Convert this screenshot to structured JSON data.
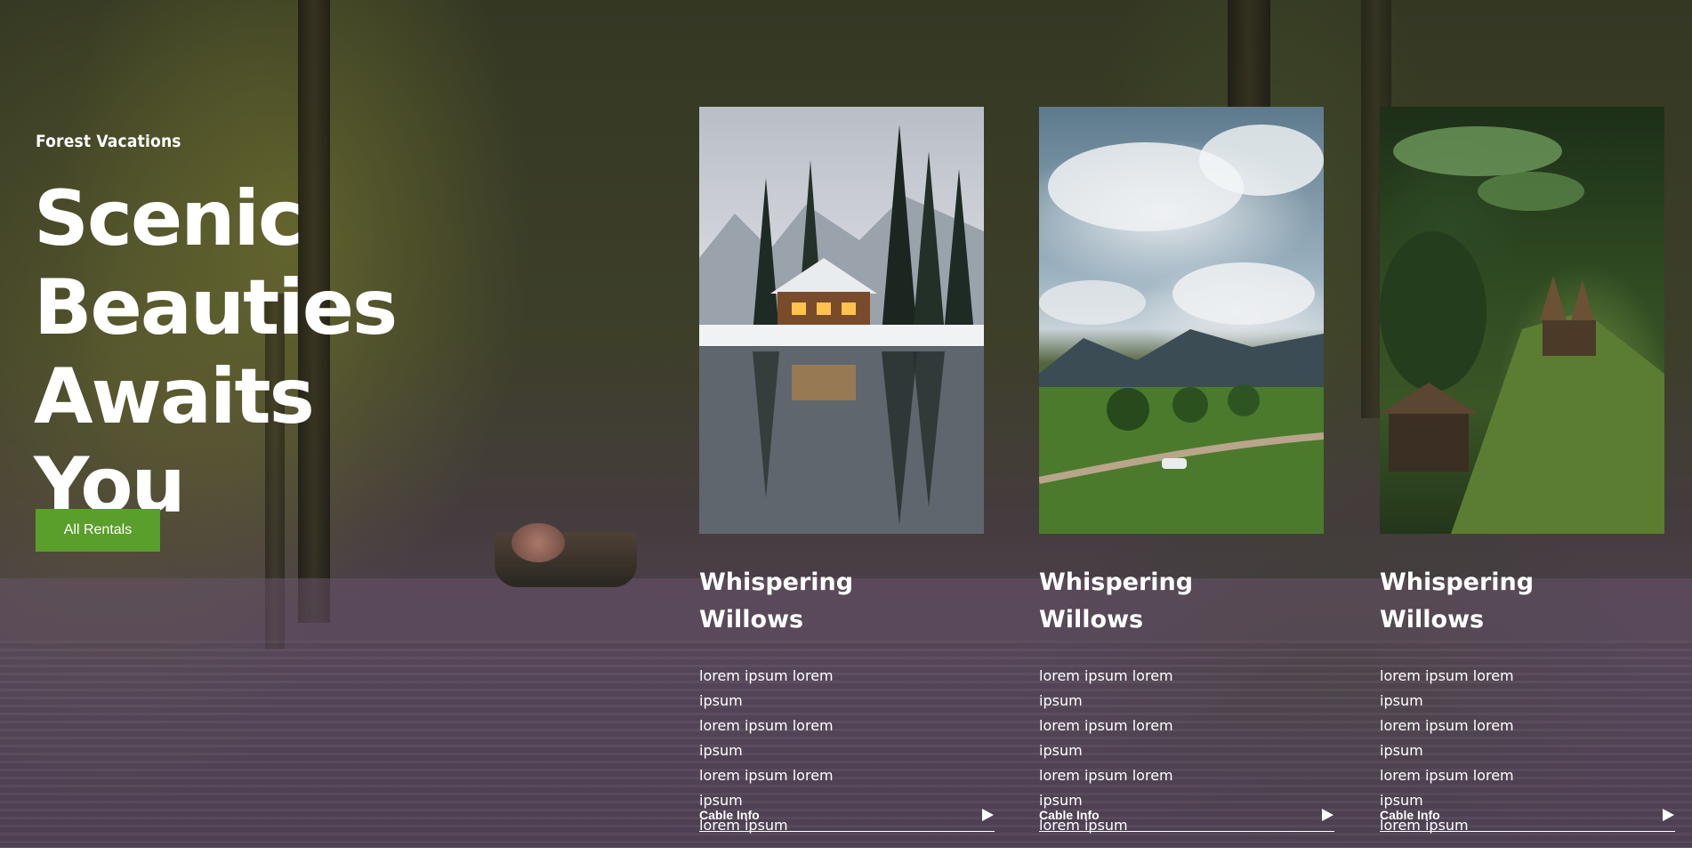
{
  "hero": {
    "eyebrow": "Forest Vacations",
    "headline_lines": [
      "Scenic",
      "Beauties",
      "Awaits You"
    ],
    "cta_label": "All Rentals",
    "cta_color": "#5a9e2c"
  },
  "cards": [
    {
      "title_lines": [
        "Whispering",
        "Willows"
      ],
      "description_lines": [
        "lorem ipsum lorem ipsum",
        "lorem ipsum lorem ipsum",
        "lorem ipsum lorem ipsum",
        "lorem ipsum"
      ],
      "link_label": "Cable Info",
      "link_icon": "play-icon",
      "photo": "snowy-lake-cabin"
    },
    {
      "title_lines": [
        "Whispering",
        "Willows"
      ],
      "description_lines": [
        "lorem ipsum lorem ipsum",
        "lorem ipsum lorem ipsum",
        "lorem ipsum lorem ipsum",
        "lorem ipsum"
      ],
      "link_label": "Cable Info",
      "link_icon": "play-icon",
      "photo": "mountain-valley-road"
    },
    {
      "title_lines": [
        "Whispering",
        "Willows"
      ],
      "description_lines": [
        "lorem ipsum lorem ipsum",
        "lorem ipsum lorem ipsum",
        "lorem ipsum lorem ipsum",
        "lorem ipsum"
      ],
      "link_label": "Cable Info",
      "link_icon": "play-icon",
      "photo": "jungle-treehouse"
    }
  ]
}
